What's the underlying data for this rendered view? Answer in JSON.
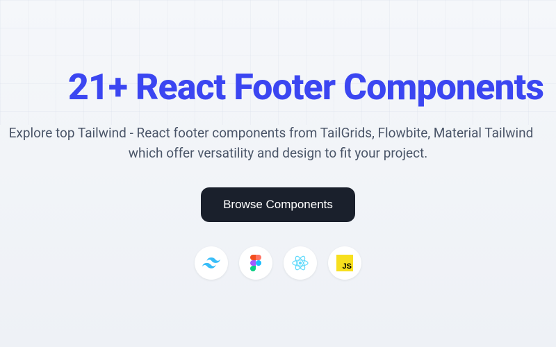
{
  "hero": {
    "title": "21+ React Footer Components",
    "subtitle_line1": "Explore top Tailwind  - React footer components from TailGrids, Flowbite, Material Tailwind",
    "subtitle_line2": "which offer versatility and design to fit your project.",
    "cta_label": "Browse Components"
  },
  "tech_icons": {
    "tailwind": "tailwind",
    "figma": "figma",
    "react": "react",
    "javascript": "JS"
  },
  "colors": {
    "primary": "#3b46f1",
    "button_bg": "#1a202c",
    "text_muted": "#4a5568"
  }
}
